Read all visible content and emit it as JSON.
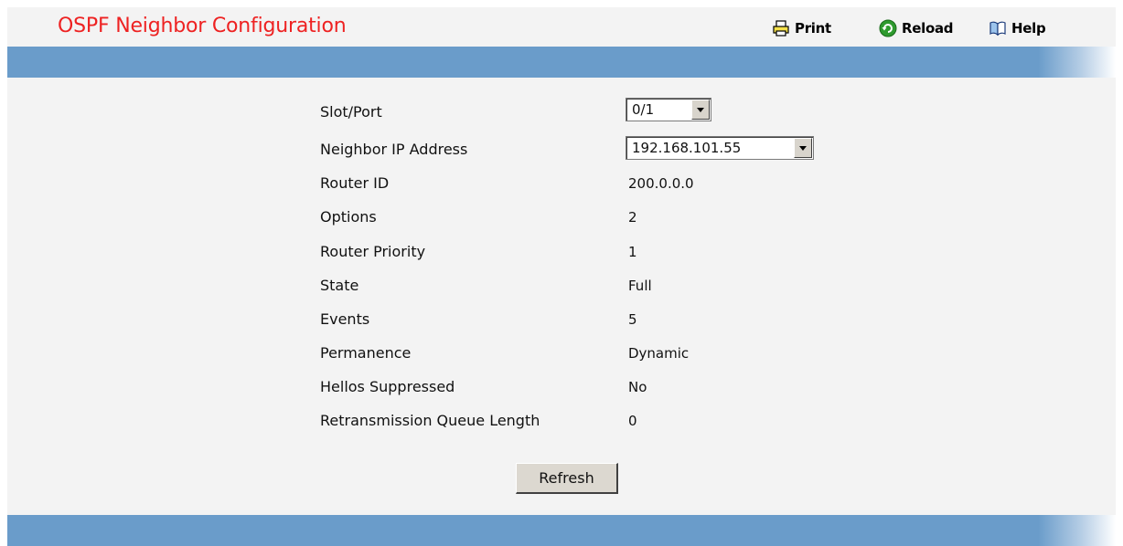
{
  "header": {
    "title": "OSPF Neighbor Configuration",
    "print_label": "Print",
    "reload_label": "Reload",
    "help_label": "Help"
  },
  "form": {
    "slot_port": {
      "label": "Slot/Port",
      "value": "0/1"
    },
    "neighbor_ip": {
      "label": "Neighbor IP Address",
      "value": "192.168.101.55"
    },
    "router_id": {
      "label": "Router ID",
      "value": "200.0.0.0"
    },
    "options": {
      "label": "Options",
      "value": "2"
    },
    "router_priority": {
      "label": "Router Priority",
      "value": "1"
    },
    "state": {
      "label": "State",
      "value": "Full"
    },
    "events": {
      "label": "Events",
      "value": "5"
    },
    "permanence": {
      "label": "Permanence",
      "value": "Dynamic"
    },
    "hellos_suppressed": {
      "label": "Hellos Suppressed",
      "value": "No"
    },
    "retransmission_queue_length": {
      "label": "Retransmission Queue Length",
      "value": "0"
    }
  },
  "actions": {
    "refresh_label": "Refresh"
  },
  "colors": {
    "title": "#ee2222",
    "band": "#6a9cca",
    "page_bg": "#f3f3f3"
  }
}
